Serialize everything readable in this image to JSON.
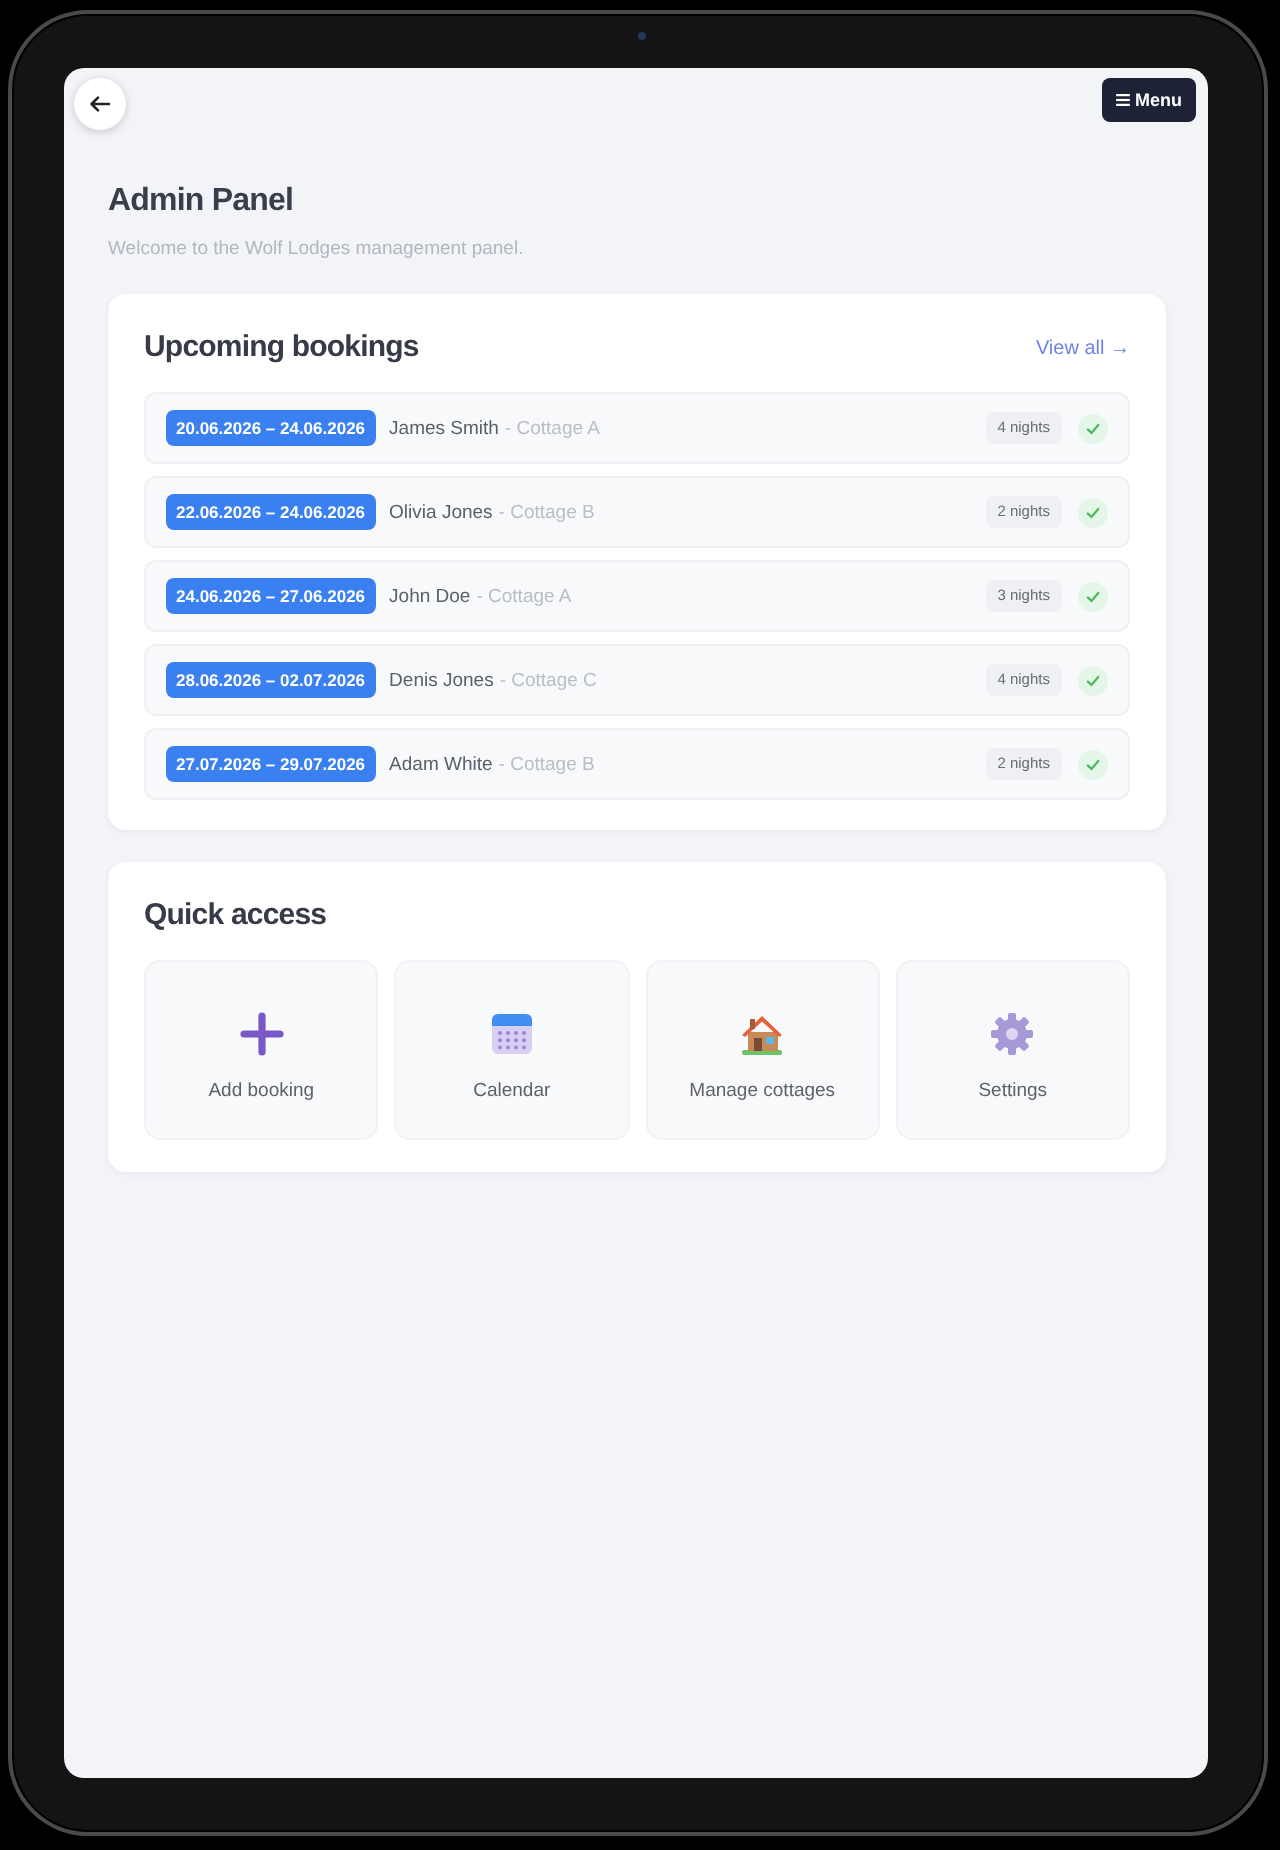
{
  "header": {
    "menu_button": {
      "label": "Menu"
    }
  },
  "page": {
    "title": "Admin Panel",
    "subtitle": "Welcome to the Wolf Lodges management panel."
  },
  "upcoming_bookings": {
    "title": "Upcoming bookings",
    "view_all": "View all →",
    "bookings": [
      {
        "dates": "20.06.2026 – 24.06.2026",
        "guest": "James Smith",
        "cottage": "- Cottage A",
        "nights": "4 nights",
        "confirmed": true
      },
      {
        "dates": "22.06.2026 – 24.06.2026",
        "guest": "Olivia Jones",
        "cottage": "- Cottage B",
        "nights": "2 nights",
        "confirmed": true
      },
      {
        "dates": "24.06.2026 – 27.06.2026",
        "guest": "John Doe",
        "cottage": "- Cottage A",
        "nights": "3 nights",
        "confirmed": true
      },
      {
        "dates": "28.06.2026 – 02.07.2026",
        "guest": "Denis Jones",
        "cottage": "- Cottage C",
        "nights": "4 nights",
        "confirmed": true
      },
      {
        "dates": "27.07.2026 – 29.07.2026",
        "guest": "Adam White",
        "cottage": "- Cottage B",
        "nights": "2 nights",
        "confirmed": true
      }
    ]
  },
  "quick_access": {
    "title": "Quick access",
    "items": [
      {
        "kind": "add",
        "label": "Add booking"
      },
      {
        "kind": "calendar",
        "label": "Calendar"
      },
      {
        "kind": "cottages",
        "label": "Manage cottages"
      },
      {
        "kind": "settings",
        "label": "Settings"
      }
    ]
  }
}
